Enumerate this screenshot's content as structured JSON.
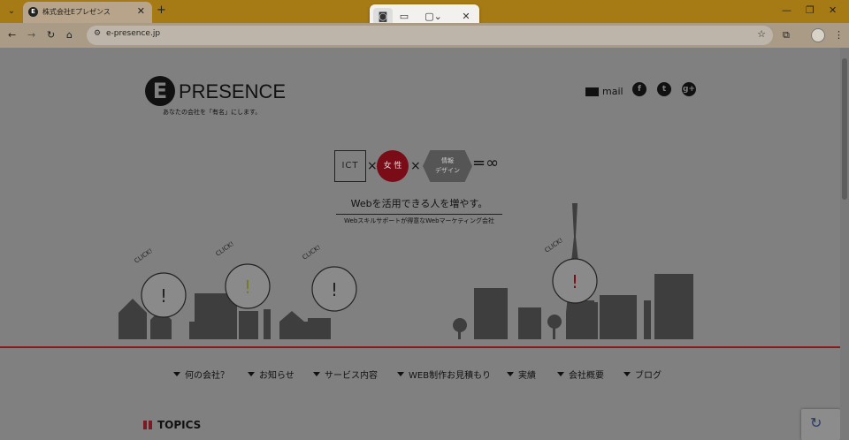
{
  "browser": {
    "tab_title": "株式会社Eプレゼンス",
    "url": "e-presence.jp"
  },
  "capture_toolbar": {
    "mode": "screenshot"
  },
  "site": {
    "logo_word": "PRESENCE",
    "logo_letter": "E",
    "tagline": "あなたの会社を「有名」にします。",
    "mail_label": "mail",
    "formula": {
      "ict": "ICT",
      "josei": "女 性",
      "design_line1": "情報",
      "design_line2": "デザイン",
      "times": "×",
      "result": "=∞"
    },
    "headline": "Webを活用できる人を増やす。",
    "subline": "Webスキルサポートが得意なWebマーケティング会社",
    "bubble_text": "CLICK!",
    "nav": [
      "何の会社？",
      "お知らせ",
      "サービス内容",
      "WEB制作お見積もり",
      "実績",
      "会社概要",
      "ブログ"
    ],
    "topics_label": "TOPICS"
  },
  "colors": {
    "tab_strip": "#a67a14",
    "accent_red": "#7a0c18",
    "page_bg": "#808080"
  }
}
